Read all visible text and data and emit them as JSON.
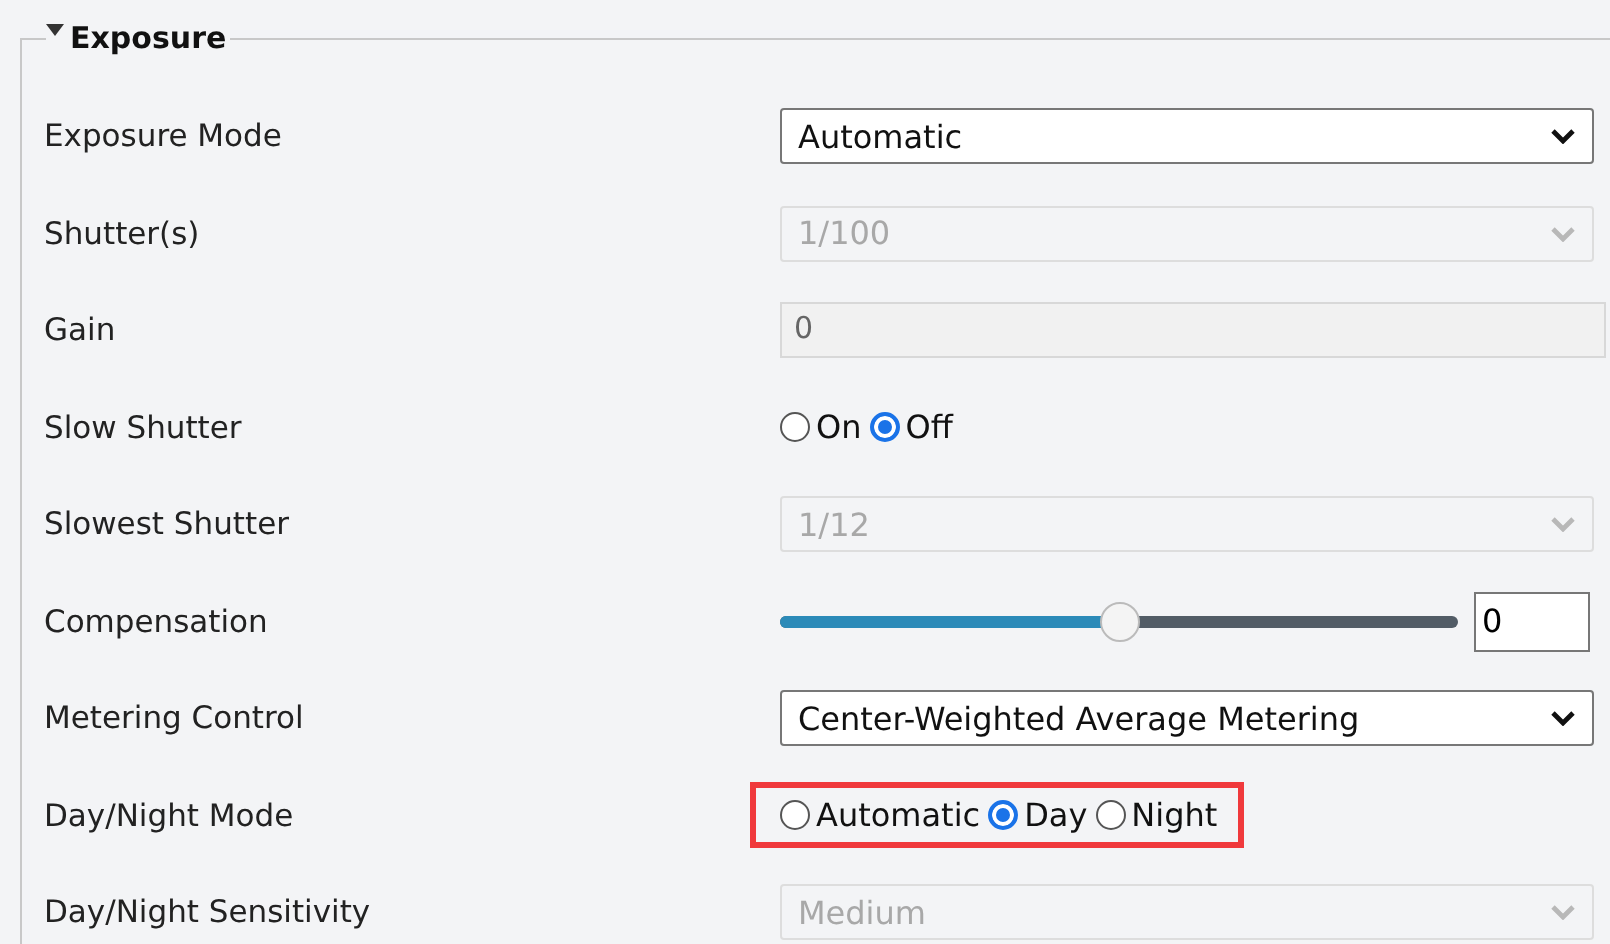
{
  "section": {
    "title": "Exposure",
    "expanded": true
  },
  "rows": [
    {
      "label": "Exposure Mode",
      "kind": "select",
      "value": "Automatic",
      "disabled": false
    },
    {
      "label": "Shutter(s)",
      "kind": "select",
      "value": "1/100",
      "disabled": true
    },
    {
      "label": "Gain",
      "kind": "text",
      "value": "0",
      "disabled": true
    },
    {
      "label": "Slow Shutter",
      "kind": "radio",
      "options": [
        {
          "label": "On",
          "selected": false
        },
        {
          "label": "Off",
          "selected": true
        }
      ]
    },
    {
      "label": "Slowest Shutter",
      "kind": "select",
      "value": "1/12",
      "disabled": true
    },
    {
      "label": "Compensation",
      "kind": "slider",
      "level": 0.5,
      "value": "0"
    },
    {
      "label": "Metering Control",
      "kind": "select",
      "value": "Center-Weighted Average Metering",
      "disabled": false
    },
    {
      "label": "Day/Night Mode",
      "kind": "radio",
      "highlighted": true,
      "options": [
        {
          "label": "Automatic",
          "selected": false
        },
        {
          "label": "Day",
          "selected": true
        },
        {
          "label": "Night",
          "selected": false
        }
      ]
    },
    {
      "label": "Day/Night Sensitivity",
      "kind": "select",
      "value": "Medium",
      "disabled": true
    }
  ]
}
